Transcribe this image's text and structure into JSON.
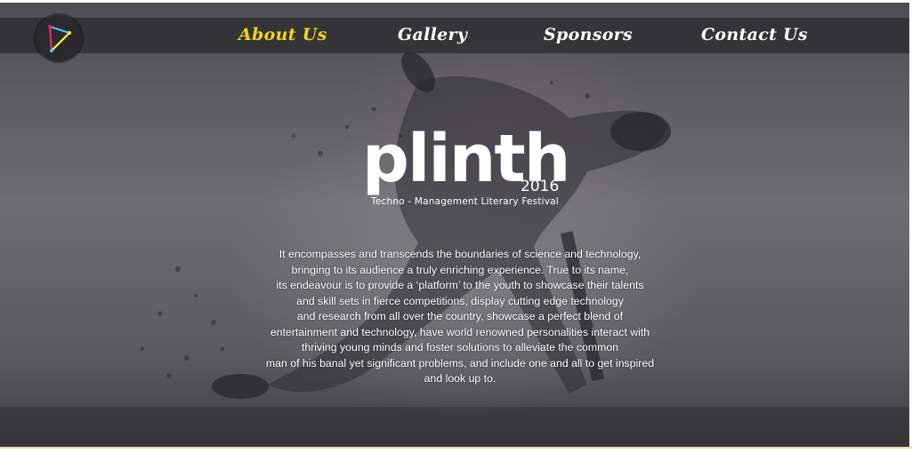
{
  "nav": {
    "logo_icon": "triangle-logo-icon",
    "items": [
      {
        "label": "About Us",
        "active": true
      },
      {
        "label": "Gallery",
        "active": false
      },
      {
        "label": "Sponsors",
        "active": false
      },
      {
        "label": "Contact Us",
        "active": false
      }
    ],
    "active_color": "#f4d41c"
  },
  "brand": {
    "name": "plinth",
    "year": "2016",
    "tagline": "Techno - Management Literary Festival"
  },
  "intro": {
    "lines": [
      "It encompasses and transcends the boundaries of science and technology,",
      "bringing to its audience a truly enriching experience. True to its name,",
      "its endeavour is to provide a ‘platform’ to the youth to showcase their talents",
      "and skill sets in fierce competitions, display cutting edge technology",
      "and research from all over the country, showcase a perfect blend of",
      "entertainment and technology, have world renowned personalities interact with",
      "thriving young minds and foster solutions to alleviate the common",
      "man of his banal yet significant problems, and include one and all to get inspired",
      "and look up to."
    ]
  }
}
